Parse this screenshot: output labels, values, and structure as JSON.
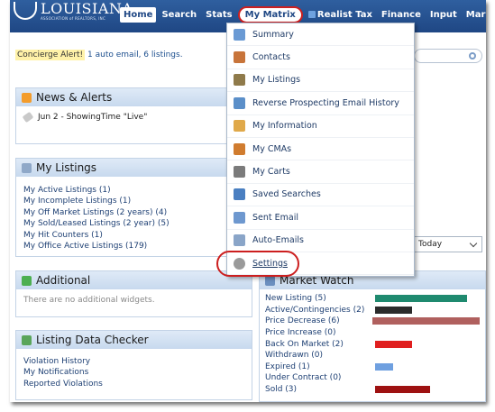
{
  "header": {
    "logo_text": "LOUISIANA",
    "logo_sub": "ASSOCIATION of REALTORS, INC",
    "nav": [
      "Home",
      "Search",
      "Stats",
      "My Matrix",
      "Realist Tax",
      "Finance",
      "Input",
      "Market Reports"
    ]
  },
  "concierge": {
    "label": "Concierge Alert!",
    "text": "1 auto email, 6 listings."
  },
  "news": {
    "title": "News & Alerts",
    "items": [
      "Jun 2 - ShowingTime \"Live\""
    ]
  },
  "my_listings": {
    "title": "My Listings",
    "items": [
      "My Active Listings (1)",
      "My Incomplete Listings (1)",
      "My Off Market Listings (2 years) (4)",
      "My Sold/Leased Listings (2 year) (5)",
      "My Hit Counters (1)",
      "My Office Active Listings (179)"
    ]
  },
  "additional": {
    "title": "Additional",
    "text": "There are no additional widgets."
  },
  "checker": {
    "title": "Listing Data Checker",
    "items": [
      "Violation History",
      "My Notifications",
      "Reported Violations"
    ]
  },
  "dropdown": {
    "items": [
      {
        "label": "Summary",
        "icon": "summary-icon",
        "color": "#6a9ad4"
      },
      {
        "label": "Contacts",
        "icon": "contacts-icon",
        "color": "#c8743a"
      },
      {
        "label": "My Listings",
        "icon": "house-icon",
        "color": "#8f7a4a"
      },
      {
        "label": "Reverse Prospecting Email History",
        "icon": "people-icon",
        "color": "#5b8fc9"
      },
      {
        "label": "My Information",
        "icon": "info-icon",
        "color": "#e0a94a"
      },
      {
        "label": "My CMAs",
        "icon": "cma-icon",
        "color": "#d07c2f"
      },
      {
        "label": "My Carts",
        "icon": "cart-icon",
        "color": "#7b7b7b"
      },
      {
        "label": "Saved Searches",
        "icon": "saved-search-icon",
        "color": "#4a7fc1"
      },
      {
        "label": "Sent Email",
        "icon": "mail-icon",
        "color": "#6e98cf"
      },
      {
        "label": "Auto-Emails",
        "icon": "auto-email-icon",
        "color": "#8aa5c8"
      },
      {
        "label": "Settings",
        "icon": "gear-icon",
        "color": "#9a9a9a"
      }
    ]
  },
  "today_select": {
    "value": "Today"
  },
  "market_watch": {
    "title": "Market Watch",
    "rows": [
      {
        "label": "New Listing (5)",
        "value": 5,
        "color": "#1f8a6f"
      },
      {
        "label": "Active/Contingencies (2)",
        "value": 2,
        "color": "#2b2b2b"
      },
      {
        "label": "Price Decrease (6)",
        "value": 6,
        "color": "#b0605e"
      },
      {
        "label": "Price Increase (0)",
        "value": 0,
        "color": "#777777"
      },
      {
        "label": "Back On Market (2)",
        "value": 2,
        "color": "#e01f1f"
      },
      {
        "label": "Withdrawn (0)",
        "value": 0,
        "color": "#777777"
      },
      {
        "label": "Expired (1)",
        "value": 1,
        "color": "#6fa0e0"
      },
      {
        "label": "Under Contract (0)",
        "value": 0,
        "color": "#777777"
      },
      {
        "label": "Sold (3)",
        "value": 3,
        "color": "#9e1111"
      }
    ]
  }
}
